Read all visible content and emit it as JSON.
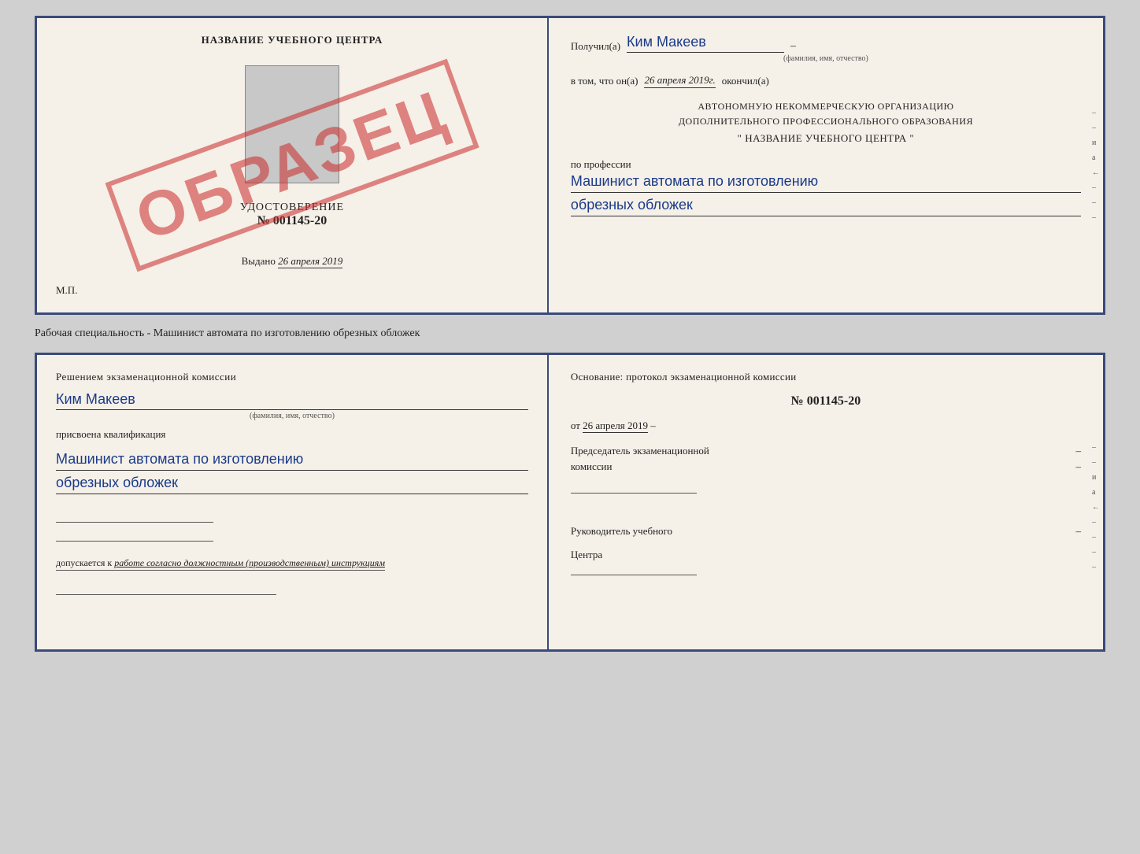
{
  "top_cert": {
    "left": {
      "school_name": "НАЗВАНИЕ УЧЕБНОГО ЦЕНТРА",
      "watermark": "ОБРАЗЕЦ",
      "udostoverenie_title": "УДОСТОВЕРЕНИЕ",
      "cert_number": "№ 001145-20",
      "vydano_label": "Выдано",
      "vydano_date": "26 апреля 2019",
      "mp_label": "М.П."
    },
    "right": {
      "poluchil_label": "Получил(а)",
      "recipient_name": "Ким Макеев",
      "fio_caption": "(фамилия, имя, отчество)",
      "vtom_label": "в том, что он(а)",
      "completion_date": "26 апреля 2019г.",
      "okonchil_label": "окончил(а)",
      "org_line1": "АВТОНОМНУЮ НЕКОММЕРЧЕСКУЮ ОРГАНИЗАЦИЮ",
      "org_line2": "ДОПОЛНИТЕЛЬНОГО ПРОФЕССИОНАЛЬНОГО ОБРАЗОВАНИЯ",
      "org_name": "\"  НАЗВАНИЕ УЧЕБНОГО ЦЕНТРА  \"",
      "po_professii_label": "по профессии",
      "profession_line1": "Машинист автомата по изготовлению",
      "profession_line2": "обрезных обложек"
    }
  },
  "separator": {
    "text": "Рабочая специальность - Машинист автомата по изготовлению обрезных обложек"
  },
  "bottom_cert": {
    "left": {
      "resheniem_label": "Решением экзаменационной комиссии",
      "komissia_name": "Ким Макеев",
      "fio_caption": "(фамилия, имя, отчество)",
      "prisvoena_label": "присвоена квалификация",
      "qualification_line1": "Машинист автомата по изготовлению",
      "qualification_line2": "обрезных обложек",
      "dopuskaetsya_label": "допускается к",
      "dopuskaetsya_value": "работе согласно должностным (производственным) инструкциям"
    },
    "right": {
      "osnovaniye_label": "Основание: протокол экзаменационной комиссии",
      "protocol_number": "№  001145-20",
      "ot_label": "от",
      "protocol_date": "26 апреля 2019",
      "predsedatel_line1": "Председатель экзаменационной",
      "predsedatel_line2": "комиссии",
      "rukovoditel_line1": "Руководитель учебного",
      "rukovoditel_line2": "Центра"
    }
  },
  "edge_marks": {
    "dashes": [
      "-",
      "-",
      "и",
      "а",
      "←",
      "-",
      "-",
      "-",
      "-"
    ]
  }
}
